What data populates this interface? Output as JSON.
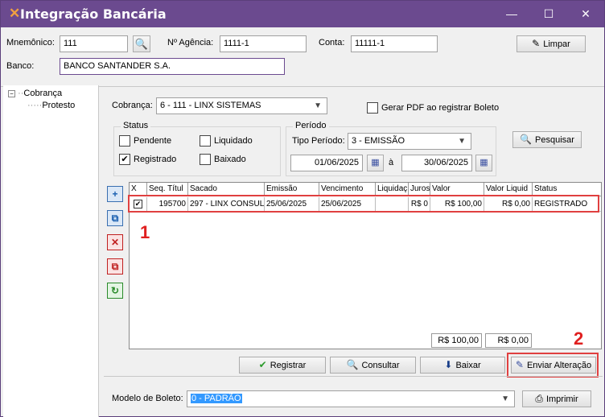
{
  "window": {
    "title": "Integração Bancária",
    "minimize": "—",
    "maximize": "☐",
    "close": "✕"
  },
  "header": {
    "mnemonico_label": "Mnemônico:",
    "mnemonico_value": "111",
    "agencia_label": "Nº Agência:",
    "agencia_value": "1111-1",
    "conta_label": "Conta:",
    "conta_value": "11111-1",
    "limpar_label": "Limpar",
    "banco_label": "Banco:",
    "banco_value": "BANCO SANTANDER S.A."
  },
  "tree": {
    "items": [
      {
        "label": "Cobrança"
      },
      {
        "label": "Protesto"
      }
    ]
  },
  "filters": {
    "cobranca_label": "Cobrança:",
    "cobranca_value": "6 - 111 - LINX SISTEMAS",
    "gerar_pdf_label": "Gerar PDF ao registrar Boleto",
    "status_legend": "Status",
    "pendente": "Pendente",
    "liquidado": "Liquidado",
    "registrado": "Registrado",
    "baixado": "Baixado",
    "periodo_legend": "Período",
    "tipo_periodo_label": "Tipo Período:",
    "tipo_periodo_value": "3 - EMISSÃO",
    "data_inicio": "01/06/2025",
    "a_label": "à",
    "data_fim": "30/06/2025",
    "pesquisar_label": "Pesquisar"
  },
  "grid": {
    "columns": [
      "X",
      "Seq. Títul",
      "Sacado",
      "Emissão",
      "Vencimento",
      "Liquidaç",
      "Juros",
      "Valor",
      "Valor Liquid",
      "Status"
    ],
    "rows": [
      {
        "checked": "✔",
        "seq": "195700",
        "sacado": "297 - LINX CONSUL",
        "emissao": "25/06/2025",
        "vencimento": "25/06/2025",
        "liquidacao": "",
        "juros": "R$ 0",
        "valor": "R$ 100,00",
        "valor_liquido": "R$ 0,00",
        "status": "REGISTRADO"
      }
    ],
    "total_valor": "R$ 100,00",
    "total_liquido": "R$ 0,00"
  },
  "annotations": {
    "one": "1",
    "two": "2"
  },
  "actions": {
    "registrar": "Registrar",
    "consultar": "Consultar",
    "baixar": "Baixar",
    "enviar_alteracao": "Enviar Alteração"
  },
  "footer": {
    "modelo_label": "Modelo de Boleto:",
    "modelo_value": "0 - PADRÃO",
    "imprimir": "Imprimir"
  },
  "colors": {
    "titlebar": "#6b4a8f",
    "highlight": "#e04040",
    "selection": "#3399ff"
  }
}
